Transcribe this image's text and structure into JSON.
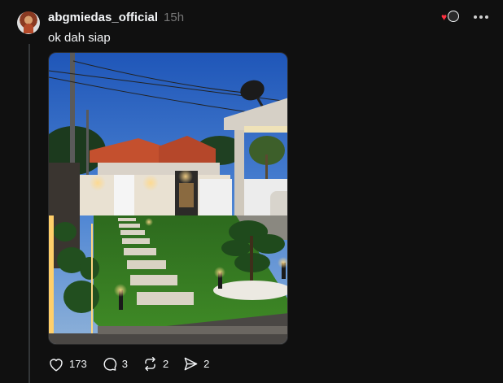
{
  "post": {
    "username": "abgmiedas_official",
    "timestamp": "15h",
    "caption": "ok dah siap",
    "avatar_icon": "profile-photo",
    "image_description": "photo"
  },
  "actions": {
    "likes": "173",
    "comments": "3",
    "reposts": "2",
    "shares": "2"
  },
  "colors": {
    "background": "#101010",
    "text": "#f3f5f7",
    "muted": "#777777",
    "like_red": "#ff3040"
  }
}
